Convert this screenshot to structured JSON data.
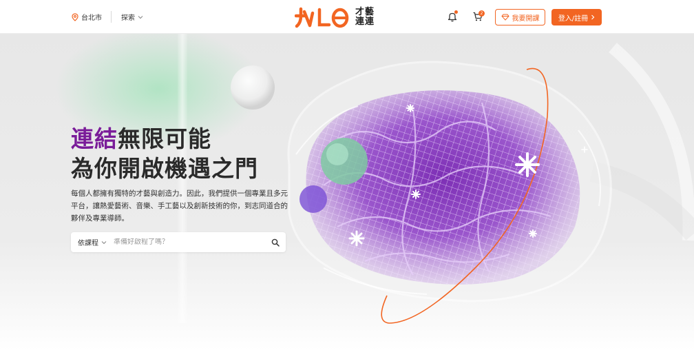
{
  "header": {
    "location_label": "台北市",
    "explore_label": "探索",
    "logo_text_line1": "才藝",
    "logo_text_line2": "連連",
    "cart_count": "2",
    "open_course_label": "我要開課",
    "login_label": "登入/註冊"
  },
  "hero": {
    "headline_accent": "連結",
    "headline_rest": "無限可能",
    "headline_line2": "為你開啟機遇之門",
    "description": "每個人都擁有獨特的才藝與創造力。因此，我們提供一個專業且多元平台，讓熱愛藝術、音樂、手工藝以及創新技術的你，到志同道合的夥伴及專業導師。"
  },
  "search": {
    "category_label": "依課程",
    "placeholder": "準備好啟程了嗎？"
  },
  "colors": {
    "brand_orange": "#f26522",
    "accent_purple": "#7a1c99"
  },
  "icons": [
    "location-pin-icon",
    "chevron-down-icon",
    "bell-icon",
    "cart-icon",
    "diamond-icon",
    "chevron-right-icon",
    "search-icon"
  ]
}
